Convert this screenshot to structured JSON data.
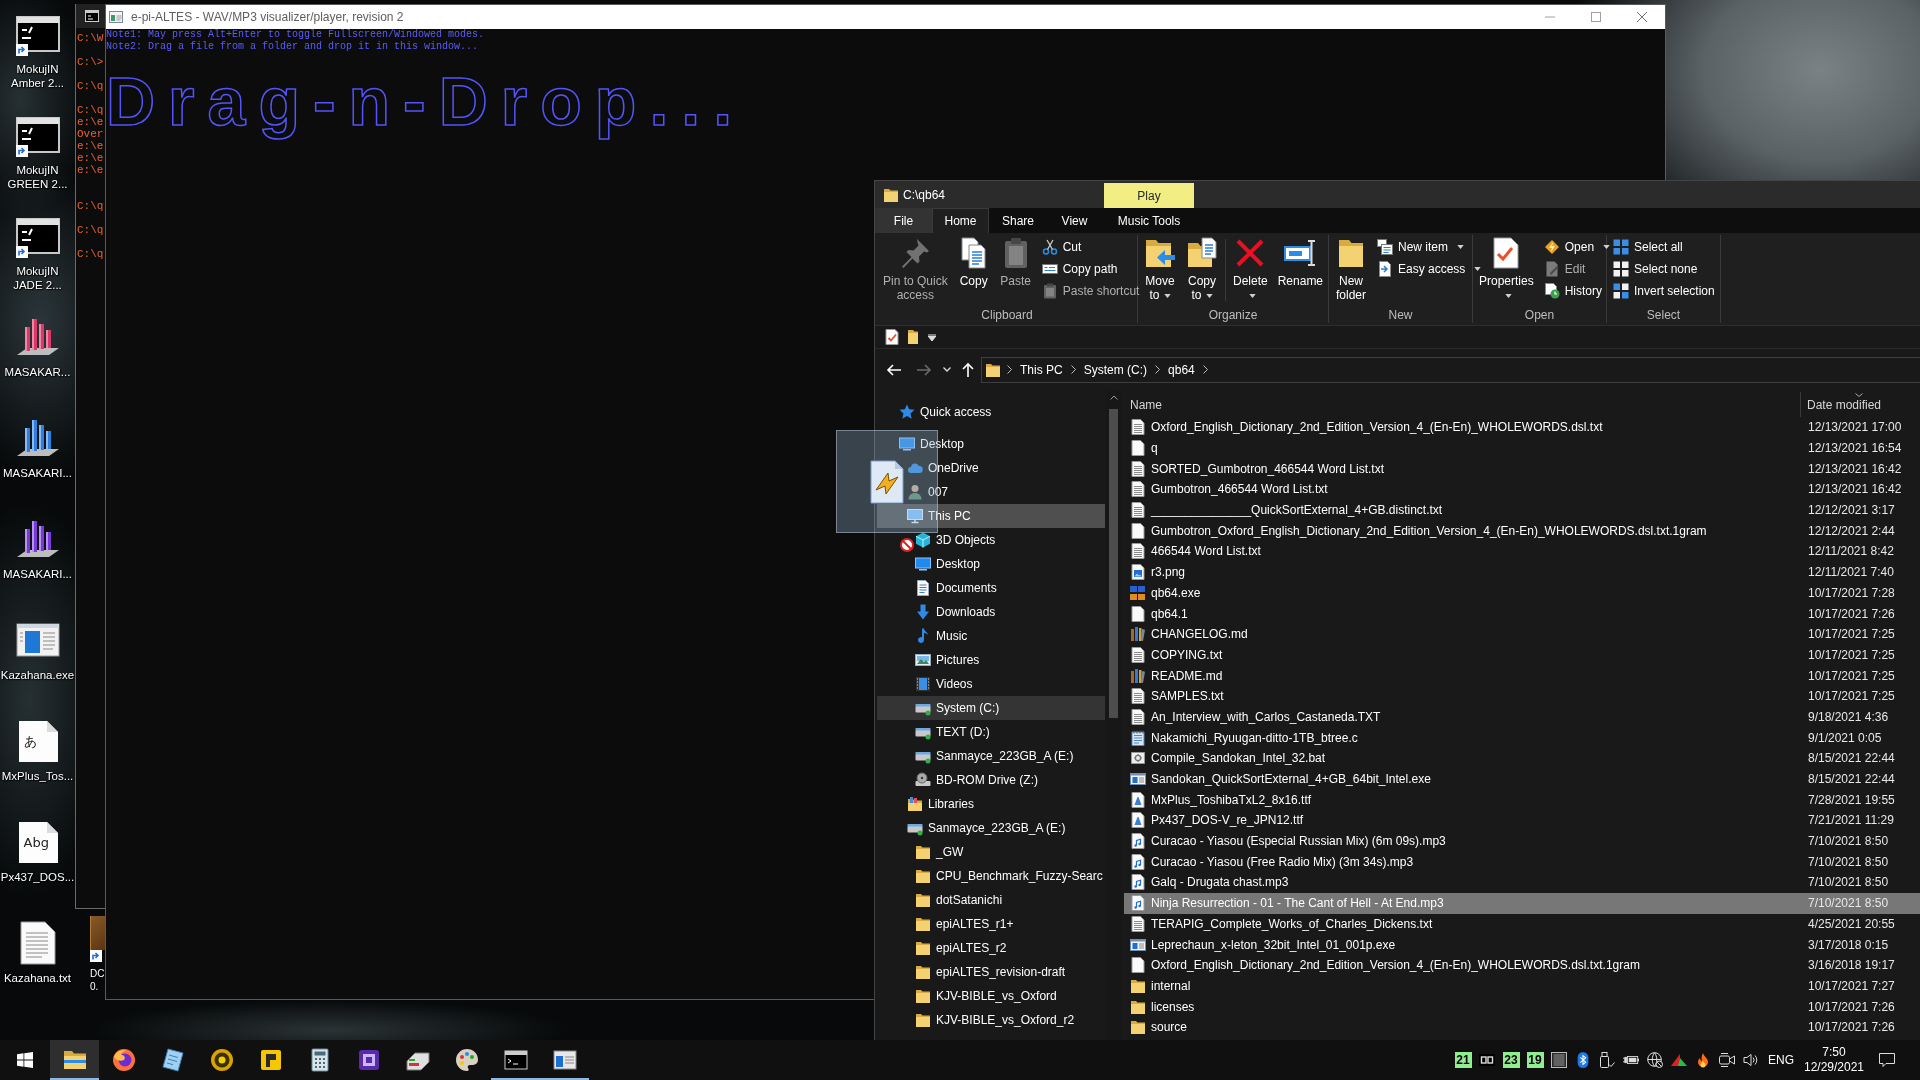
{
  "desktop": {
    "icons": [
      {
        "label": "MokujIN Amber 2...",
        "kind": "console",
        "shortcut": true
      },
      {
        "label": "MokujIN GREEN 2...",
        "kind": "console",
        "shortcut": true
      },
      {
        "label": "MokujIN JADE 2...",
        "kind": "console",
        "shortcut": true
      },
      {
        "label": "MASAKAR...",
        "kind": "bars",
        "shortcut": false
      },
      {
        "label": "MASAKARI...",
        "kind": "bars",
        "shortcut": false
      },
      {
        "label": "MASAKARI...",
        "kind": "bars",
        "shortcut": false
      },
      {
        "label": "Kazahana.exe",
        "kind": "app",
        "shortcut": false
      },
      {
        "label": "MxPlus_Tos...",
        "kind": "font",
        "preview": "あ",
        "shortcut": false
      },
      {
        "label": "Px437_DOS...",
        "kind": "font",
        "preview": "Abg",
        "shortcut": false
      },
      {
        "label": "Kazahana.txt",
        "kind": "text",
        "shortcut": false
      }
    ],
    "partial_icon": {
      "label": "DC 0.",
      "shortcut": true
    }
  },
  "back_console": {
    "lines": [
      "C:\\W",
      "C:\\>",
      "C:\\q",
      "C:\\q",
      "e:\\e",
      "Over",
      "e:\\e",
      "e:\\e",
      "e:\\e",
      "C:\\q",
      "C:\\q",
      "C:\\q"
    ]
  },
  "console": {
    "title": "e-pi-ALTES - WAV/MP3 visualizer/player, revision 2",
    "lines": [
      "Note1: May press Alt+Enter to toggle Fullscreen/Windowed modes.",
      "Note2: Drag a file from a folder and drop it in this window..."
    ],
    "banner": "Drag-n-Drop..."
  },
  "explorer": {
    "title": "C:\\qb64",
    "context_tab": "Play",
    "tabs": [
      {
        "label": "File",
        "selected": false
      },
      {
        "label": "Home",
        "selected": true
      },
      {
        "label": "Share",
        "selected": false
      },
      {
        "label": "View",
        "selected": false
      },
      {
        "label": "Music Tools",
        "selected": false
      }
    ],
    "ribbon": [
      {
        "label": "Clipboard",
        "items": [
          {
            "label": "Pin to Quick access",
            "kind": "large",
            "disabled": true,
            "dropdown": false
          },
          {
            "label": "Copy",
            "kind": "large",
            "disabled": false,
            "dropdown": false
          },
          {
            "label": "Paste",
            "kind": "large",
            "disabled": true,
            "dropdown": false
          },
          {
            "label": "Cut",
            "kind": "small",
            "disabled": false,
            "dropdown": false
          },
          {
            "label": "Copy path",
            "kind": "small",
            "disabled": false,
            "dropdown": false
          },
          {
            "label": "Paste shortcut",
            "kind": "small",
            "disabled": true,
            "dropdown": false
          }
        ]
      },
      {
        "label": "Organize",
        "items": [
          {
            "label": "Move to",
            "kind": "large",
            "disabled": false,
            "dropdown": true
          },
          {
            "label": "Copy to",
            "kind": "large",
            "disabled": false,
            "dropdown": true
          },
          {
            "kind": "separator"
          },
          {
            "label": "Delete",
            "kind": "large",
            "disabled": false,
            "dropdown": true
          },
          {
            "label": "Rename",
            "kind": "large",
            "disabled": false,
            "dropdown": false
          }
        ]
      },
      {
        "label": "New",
        "items": [
          {
            "label": "New folder",
            "kind": "large",
            "disabled": false,
            "dropdown": false
          },
          {
            "label": "New item",
            "kind": "small",
            "disabled": false,
            "dropdown": true
          },
          {
            "label": "Easy access",
            "kind": "small",
            "disabled": false,
            "dropdown": true
          }
        ]
      },
      {
        "label": "Open",
        "items": [
          {
            "label": "Properties",
            "kind": "large",
            "disabled": false,
            "dropdown": true
          },
          {
            "label": "Open",
            "kind": "small",
            "disabled": false,
            "dropdown": true
          },
          {
            "label": "Edit",
            "kind": "small",
            "disabled": true,
            "dropdown": false
          },
          {
            "label": "History",
            "kind": "small",
            "disabled": false,
            "dropdown": false
          }
        ]
      },
      {
        "label": "Select",
        "items": [
          {
            "label": "Select all",
            "kind": "small",
            "disabled": false,
            "dropdown": false
          },
          {
            "label": "Select none",
            "kind": "small",
            "disabled": false,
            "dropdown": false
          },
          {
            "label": "Invert selection",
            "kind": "small",
            "disabled": false,
            "dropdown": false
          }
        ]
      }
    ],
    "address": {
      "back_disabled": false,
      "forward_disabled": true,
      "path": [
        "This PC",
        "System (C:)",
        "qb64"
      ]
    },
    "nav": [
      {
        "label": "Quick access",
        "kind": "quick",
        "selected": false,
        "hovered": false
      },
      {
        "label": "Desktop",
        "kind": "desktop",
        "selected": false,
        "hovered": false,
        "children": [
          {
            "label": "OneDrive",
            "kind": "cloud",
            "selected": false,
            "hovered": false
          },
          {
            "label": "007",
            "kind": "user",
            "selected": false,
            "hovered": false
          },
          {
            "label": "This PC",
            "kind": "pc",
            "selected": false,
            "hovered": true,
            "children": [
              {
                "label": "3D Objects",
                "kind": "cube",
                "selected": false,
                "hovered": false
              },
              {
                "label": "Desktop",
                "kind": "desktop",
                "selected": false,
                "hovered": false
              },
              {
                "label": "Documents",
                "kind": "documents",
                "selected": false,
                "hovered": false
              },
              {
                "label": "Downloads",
                "kind": "downloads",
                "selected": false,
                "hovered": false
              },
              {
                "label": "Music",
                "kind": "music",
                "selected": false,
                "hovered": false
              },
              {
                "label": "Pictures",
                "kind": "pictures",
                "selected": false,
                "hovered": false
              },
              {
                "label": "Videos",
                "kind": "videos",
                "selected": false,
                "hovered": false
              },
              {
                "label": "System (C:)",
                "kind": "drive",
                "selected": true,
                "hovered": false
              },
              {
                "label": "TEXT (D:)",
                "kind": "drive",
                "selected": false,
                "hovered": false
              },
              {
                "label": "Sanmayce_223GB_A (E:)",
                "kind": "drive",
                "selected": false,
                "hovered": false
              },
              {
                "label": "BD-ROM Drive (Z:)",
                "kind": "optical",
                "selected": false,
                "hovered": false
              }
            ]
          },
          {
            "label": "Libraries",
            "kind": "libraries",
            "selected": false,
            "hovered": false
          },
          {
            "label": "Sanmayce_223GB_A (E:)",
            "kind": "drive",
            "selected": false,
            "hovered": false,
            "children": [
              {
                "label": "_GW",
                "kind": "folder",
                "selected": false,
                "hovered": false
              },
              {
                "label": "CPU_Benchmark_Fuzzy-Searc",
                "kind": "folder",
                "selected": false,
                "hovered": false
              },
              {
                "label": "dotSatanichi",
                "kind": "folder",
                "selected": false,
                "hovered": false
              },
              {
                "label": "epiALTES_r1+",
                "kind": "folder",
                "selected": false,
                "hovered": false
              },
              {
                "label": "epiALTES_r2",
                "kind": "folder",
                "selected": false,
                "hovered": false
              },
              {
                "label": "epiALTES_revision-draft",
                "kind": "folder",
                "selected": false,
                "hovered": false
              },
              {
                "label": "KJV-BIBLE_vs_Oxford",
                "kind": "folder",
                "selected": false,
                "hovered": false
              },
              {
                "label": "KJV-BIBLE_vs_Oxford_r2",
                "kind": "folder",
                "selected": false,
                "hovered": false
              }
            ]
          }
        ]
      }
    ],
    "columns": [
      {
        "label": "Name",
        "sorted": false
      },
      {
        "label": "Date modified",
        "sorted": true
      }
    ],
    "files": [
      {
        "name": "Oxford_English_Dictionary_2nd_Edition_Version_4_(En-En)_WHOLEWORDS.dsl.txt",
        "date": "12/13/2021 17:00",
        "kind": "text",
        "selected": false
      },
      {
        "name": "q",
        "date": "12/13/2021 16:54",
        "kind": "blank",
        "selected": false
      },
      {
        "name": "SORTED_Gumbotron_466544 Word List.txt",
        "date": "12/13/2021 16:42",
        "kind": "text",
        "selected": false
      },
      {
        "name": "Gumbotron_466544 Word List.txt",
        "date": "12/13/2021 16:42",
        "kind": "text",
        "selected": false
      },
      {
        "name": "_______________QuickSortExternal_4+GB.distinct.txt",
        "date": "12/12/2021 3:17",
        "kind": "text",
        "selected": false
      },
      {
        "name": "Gumbotron_Oxford_English_Dictionary_2nd_Edition_Version_4_(En-En)_WHOLEWORDS.dsl.txt.1gram",
        "date": "12/12/2021 2:44",
        "kind": "blank",
        "selected": false
      },
      {
        "name": "466544 Word List.txt",
        "date": "12/11/2021 8:42",
        "kind": "text",
        "selected": false
      },
      {
        "name": "r3.png",
        "date": "12/11/2021 7:40",
        "kind": "image",
        "selected": false
      },
      {
        "name": "qb64.exe",
        "date": "10/17/2021 7:28",
        "kind": "qb64",
        "selected": false
      },
      {
        "name": "qb64.1",
        "date": "10/17/2021 7:26",
        "kind": "blank",
        "selected": false
      },
      {
        "name": "CHANGELOG.md",
        "date": "10/17/2021 7:25",
        "kind": "md",
        "selected": false
      },
      {
        "name": "COPYING.txt",
        "date": "10/17/2021 7:25",
        "kind": "text",
        "selected": false
      },
      {
        "name": "README.md",
        "date": "10/17/2021 7:25",
        "kind": "md",
        "selected": false
      },
      {
        "name": "SAMPLES.txt",
        "date": "10/17/2021 7:25",
        "kind": "text",
        "selected": false
      },
      {
        "name": "An_Interview_with_Carlos_Castaneda.TXT",
        "date": "9/18/2021 4:36",
        "kind": "text",
        "selected": false
      },
      {
        "name": "Nakamichi_Ryuugan-ditto-1TB_btree.c",
        "date": "9/1/2021 0:05",
        "kind": "code",
        "selected": false
      },
      {
        "name": "Compile_Sandokan_Intel_32.bat",
        "date": "8/15/2021 22:44",
        "kind": "script",
        "selected": false
      },
      {
        "name": "Sandokan_QuickSortExternal_4+GB_64bit_Intel.exe",
        "date": "8/15/2021 22:44",
        "kind": "exe",
        "selected": false
      },
      {
        "name": "MxPlus_ToshibaTxL2_8x16.ttf",
        "date": "7/28/2021 19:55",
        "kind": "font",
        "selected": false
      },
      {
        "name": "Px437_DOS-V_re_JPN12.ttf",
        "date": "7/21/2021 11:29",
        "kind": "font",
        "selected": false
      },
      {
        "name": "Curacao - Yiasou (Especial Russian Mix) (6m 09s).mp3",
        "date": "7/10/2021 8:50",
        "kind": "audio",
        "selected": false
      },
      {
        "name": "Curacao - Yiasou (Free Radio Mix) (3m 34s).mp3",
        "date": "7/10/2021 8:50",
        "kind": "audio",
        "selected": false
      },
      {
        "name": "Galq - Drugata chast.mp3",
        "date": "7/10/2021 8:50",
        "kind": "audio",
        "selected": false
      },
      {
        "name": "Ninja Resurrection - 01 - The Cant of Hell - At End.mp3",
        "date": "7/10/2021 8:50",
        "kind": "audio",
        "selected": true
      },
      {
        "name": "TERAPIG_Complete_Works_of_Charles_Dickens.txt",
        "date": "4/25/2021 20:55",
        "kind": "text",
        "selected": false
      },
      {
        "name": "Leprechaun_x-leton_32bit_Intel_01_001p.exe",
        "date": "3/17/2018 0:15",
        "kind": "exe",
        "selected": false
      },
      {
        "name": "Oxford_English_Dictionary_2nd_Edition_Version_4_(En-En)_WHOLEWORDS.dsl.txt.1gram",
        "date": "3/16/2018 19:17",
        "kind": "blank",
        "selected": false
      },
      {
        "name": "internal",
        "date": "10/17/2021 7:27",
        "kind": "folder",
        "selected": false
      },
      {
        "name": "licenses",
        "date": "10/17/2021 7:26",
        "kind": "folder",
        "selected": false
      },
      {
        "name": "source",
        "date": "10/17/2021 7:26",
        "kind": "folder",
        "selected": false
      }
    ]
  },
  "taskbar": {
    "apps": [
      {
        "running": true,
        "active": true
      },
      {
        "running": false,
        "active": false
      },
      {
        "running": false,
        "active": false
      },
      {
        "running": false,
        "active": false
      },
      {
        "running": false,
        "active": false
      },
      {
        "running": false,
        "active": false
      },
      {
        "running": false,
        "active": false
      },
      {
        "running": false,
        "active": false
      },
      {
        "running": false,
        "active": false
      },
      {
        "running": true,
        "active": false
      },
      {
        "running": true,
        "active": false
      }
    ],
    "counters": [
      "21",
      "23",
      "19"
    ],
    "language": "ENG",
    "time": "7:50",
    "date": "12/29/2021"
  }
}
